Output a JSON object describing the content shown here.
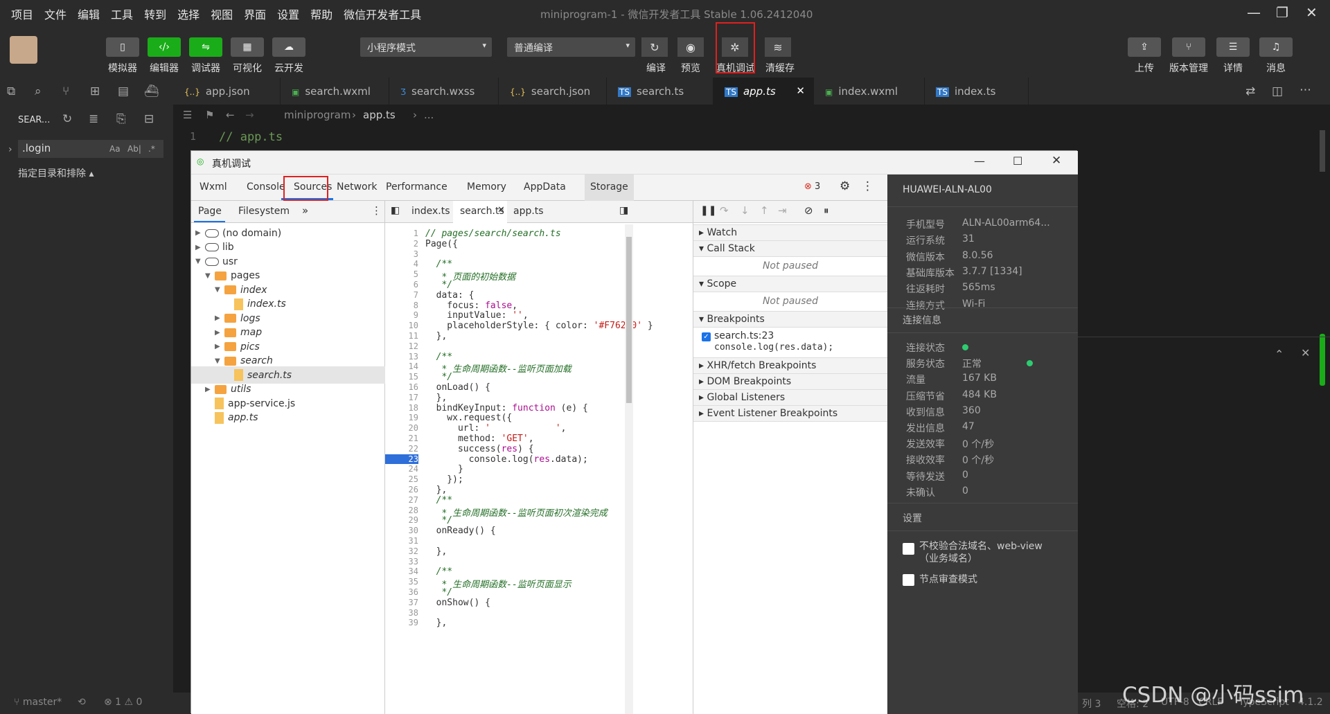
{
  "menu": [
    "项目",
    "文件",
    "编辑",
    "工具",
    "转到",
    "选择",
    "视图",
    "界面",
    "设置",
    "帮助",
    "微信开发者工具"
  ],
  "window_title": "miniprogram-1 - 微信开发者工具 Stable 1.06.2412040",
  "toolbar": {
    "simulator": "模拟器",
    "editor": "编辑器",
    "debugger": "调试器",
    "visual": "可视化",
    "cloud": "云开发",
    "mode_select": "小程序模式",
    "compile_select": "普通编译",
    "compile": "编译",
    "preview": "预览",
    "remote_debug": "真机调试",
    "clear_cache": "清缓存",
    "upload": "上传",
    "version": "版本管理",
    "details": "详情",
    "messages": "消息"
  },
  "sidebar": {
    "search_label": "SEAR...",
    "search_value": ".login",
    "search_opts": [
      "Aa",
      "Ab|",
      ".*"
    ],
    "include_exclude": "指定目录和排除 ▴"
  },
  "file_tabs": [
    {
      "icon": "{..}",
      "label": "app.json",
      "color": "#e8c35a"
    },
    {
      "icon": "▣",
      "label": "search.wxml",
      "color": "#4caf50"
    },
    {
      "icon": "Ʒ",
      "label": "search.wxss",
      "color": "#3d8fe0"
    },
    {
      "icon": "{..}",
      "label": "search.json",
      "color": "#e8c35a"
    },
    {
      "icon": "TS",
      "label": "search.ts",
      "color": "#3178c6"
    },
    {
      "icon": "TS",
      "label": "app.ts",
      "color": "#3178c6"
    },
    {
      "icon": "▣",
      "label": "index.wxml",
      "color": "#4caf50"
    },
    {
      "icon": "TS",
      "label": "index.ts",
      "color": "#3178c6"
    }
  ],
  "breadcrumb": {
    "folder": "miniprogram",
    "file": "app.ts",
    "more": "..."
  },
  "editor": {
    "line_no": "1",
    "line_text": "// app.ts"
  },
  "status": {
    "branch": "master*",
    "errors": "⊗ 1 ⚠ 0",
    "col": "列 3",
    "spaces": "空格: 2",
    "encoding": "UTF-8",
    "eol": "CRLF",
    "lang": "TypeScript",
    "ver": "4.1.2"
  },
  "watermark": "CSDN @小码ssim",
  "devtools": {
    "title": "真机调试",
    "tabs": [
      "Wxml",
      "Console",
      "Sources",
      "Network",
      "Performance",
      "Memory",
      "AppData",
      "Storage"
    ],
    "error_count": "3",
    "nav_tabs": [
      "Page",
      "Filesystem"
    ],
    "tree": [
      {
        "label": "(no domain)",
        "type": "cloud",
        "depth": 0,
        "tri": "▶"
      },
      {
        "label": "lib",
        "type": "cloud",
        "depth": 0,
        "tri": "▶"
      },
      {
        "label": "usr",
        "type": "cloud",
        "depth": 0,
        "tri": "▼"
      },
      {
        "label": "pages",
        "type": "folder",
        "depth": 1,
        "tri": "▼"
      },
      {
        "label": "index",
        "type": "folder",
        "depth": 2,
        "tri": "▼"
      },
      {
        "label": "index.ts",
        "type": "file",
        "depth": 3,
        "tri": ""
      },
      {
        "label": "logs",
        "type": "folder",
        "depth": 2,
        "tri": "▶"
      },
      {
        "label": "map",
        "type": "folder",
        "depth": 2,
        "tri": "▶"
      },
      {
        "label": "pics",
        "type": "folder",
        "depth": 2,
        "tri": "▶"
      },
      {
        "label": "search",
        "type": "folder",
        "depth": 2,
        "tri": "▼"
      },
      {
        "label": "search.ts",
        "type": "file",
        "depth": 3,
        "tri": ""
      },
      {
        "label": "utils",
        "type": "folder",
        "depth": 1,
        "tri": "▶"
      },
      {
        "label": "app-service.js",
        "type": "file",
        "depth": 1,
        "tri": ""
      },
      {
        "label": "app.ts",
        "type": "file",
        "depth": 1,
        "tri": ""
      }
    ],
    "code_tabs": [
      "index.ts",
      "search.ts",
      "app.ts"
    ],
    "code": [
      {
        "n": "1",
        "h": "<span class='cm'>// pages/search/search.ts</span>"
      },
      {
        "n": "2",
        "h": "Page({"
      },
      {
        "n": "3",
        "h": ""
      },
      {
        "n": "4",
        "h": "  <span class='cm'>/**</span>"
      },
      {
        "n": "5",
        "h": "  <span class='cm'> * 页面的初始数据</span>"
      },
      {
        "n": "6",
        "h": "  <span class='cm'> */</span>"
      },
      {
        "n": "7",
        "h": "  data: {"
      },
      {
        "n": "8",
        "h": "    focus: <span class='kw'>false</span>,"
      },
      {
        "n": "9",
        "h": "    inputValue: <span class='st'>''</span>,"
      },
      {
        "n": "10",
        "h": "    placeholderStyle: { color: <span class='st'>'#F76260'</span> }"
      },
      {
        "n": "11",
        "h": "  },"
      },
      {
        "n": "12",
        "h": ""
      },
      {
        "n": "13",
        "h": "  <span class='cm'>/**</span>"
      },
      {
        "n": "14",
        "h": "  <span class='cm'> * 生命周期函数--监听页面加载</span>"
      },
      {
        "n": "15",
        "h": "  <span class='cm'> */</span>"
      },
      {
        "n": "16",
        "h": "  onLoad() {"
      },
      {
        "n": "17",
        "h": "  },"
      },
      {
        "n": "18",
        "h": "  bindKeyInput: <span class='kw'>function</span> (e) {"
      },
      {
        "n": "19",
        "h": "    wx.request({"
      },
      {
        "n": "20",
        "h": "      url: <span class='st'>'            '</span>,"
      },
      {
        "n": "21",
        "h": "      method: <span class='st'>'GET'</span>,"
      },
      {
        "n": "22",
        "h": "      success(<span class='kw'>res</span>) {"
      },
      {
        "n": "23",
        "h": "        console.log(<span class='kw'>res</span>.data);"
      },
      {
        "n": "24",
        "h": "      }"
      },
      {
        "n": "25",
        "h": "    });"
      },
      {
        "n": "26",
        "h": "  },"
      },
      {
        "n": "27",
        "h": "  <span class='cm'>/**</span>"
      },
      {
        "n": "28",
        "h": "  <span class='cm'> * 生命周期函数--监听页面初次渲染完成</span>"
      },
      {
        "n": "29",
        "h": "  <span class='cm'> */</span>"
      },
      {
        "n": "30",
        "h": "  onReady() {"
      },
      {
        "n": "31",
        "h": ""
      },
      {
        "n": "32",
        "h": "  },"
      },
      {
        "n": "33",
        "h": ""
      },
      {
        "n": "34",
        "h": "  <span class='cm'>/**</span>"
      },
      {
        "n": "35",
        "h": "  <span class='cm'> * 生命周期函数--监听页面显示</span>"
      },
      {
        "n": "36",
        "h": "  <span class='cm'> */</span>"
      },
      {
        "n": "37",
        "h": "  onShow() {"
      },
      {
        "n": "38",
        "h": ""
      },
      {
        "n": "39",
        "h": "  },"
      }
    ],
    "breakpoint_line": "23",
    "debugger": {
      "watch": "Watch",
      "call_stack": "Call Stack",
      "not_paused": "Not paused",
      "scope": "Scope",
      "breakpoints": "Breakpoints",
      "bp_file": "search.ts:23",
      "bp_code": "console.log(res.data);",
      "xhr": "XHR/fetch Breakpoints",
      "dom": "DOM Breakpoints",
      "global": "Global Listeners",
      "event": "Event Listener Breakpoints"
    },
    "device": {
      "name": "HUAWEI-ALN-AL00",
      "rows": [
        [
          "手机型号",
          "ALN-AL00arm64..."
        ],
        [
          "运行系统",
          "31"
        ],
        [
          "微信版本",
          "8.0.56"
        ],
        [
          "基础库版本",
          "3.7.7 [1334]"
        ],
        [
          "往返耗时",
          "565ms"
        ],
        [
          "连接方式",
          "Wi-Fi"
        ]
      ],
      "conn_title": "连接信息",
      "conn_rows": [
        [
          "连接状态",
          ""
        ],
        [
          "服务状态",
          "正常"
        ],
        [
          "流量",
          "167 KB"
        ],
        [
          "压缩节省",
          "484 KB"
        ],
        [
          "收到信息",
          "360"
        ],
        [
          "发出信息",
          "47"
        ],
        [
          "发送效率",
          "0 个/秒"
        ],
        [
          "接收效率",
          "0 个/秒"
        ],
        [
          "等待发送",
          "0"
        ],
        [
          "未确认",
          "0"
        ]
      ],
      "settings": "设置",
      "opt1": "不校验合法域名、web-view（业务域名）",
      "opt2": "节点审查模式",
      "status_green": "#2ecc71"
    }
  }
}
